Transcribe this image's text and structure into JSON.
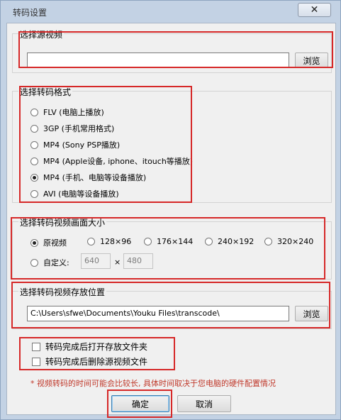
{
  "window": {
    "title": "转码设置",
    "close_symbol": "✕"
  },
  "source": {
    "group_title": "选择源视频",
    "path_value": "",
    "browse_label": "浏览"
  },
  "format": {
    "group_title": "选择转码格式",
    "options": [
      "FLV (电脑上播放)",
      "3GP (手机常用格式)",
      "MP4 (Sony PSP播放)",
      "MP4 (Apple设备, iphone、itouch等播放)",
      "MP4 (手机、电脑等设备播放)",
      "AVI (电脑等设备播放)"
    ],
    "selected_index": 4
  },
  "size": {
    "group_title": "选择转码视频画面大小",
    "options": [
      "原视频",
      "128×96",
      "176×144",
      "240×192",
      "320×240"
    ],
    "selected_index": 0,
    "custom_label": "自定义:",
    "custom_width": "640",
    "custom_height": "480",
    "times_symbol": "×"
  },
  "output": {
    "group_title": "选择转码视频存放位置",
    "path_value": "C:\\Users\\sfwe\\Documents\\Youku Files\\transcode\\",
    "browse_label": "浏览"
  },
  "options": {
    "open_folder_label": "转码完成后打开存放文件夹",
    "open_folder_checked": false,
    "delete_source_label": "转码完成后删除源视频文件",
    "delete_source_checked": false
  },
  "note": "* 视频转码的时间可能会比较长, 具体时间取决于您电脑的硬件配置情况",
  "buttons": {
    "ok_label": "确定",
    "cancel_label": "取消"
  },
  "colors": {
    "highlight": "#d62828",
    "note": "#c0392b",
    "window_frame": "#c3d2e4"
  }
}
